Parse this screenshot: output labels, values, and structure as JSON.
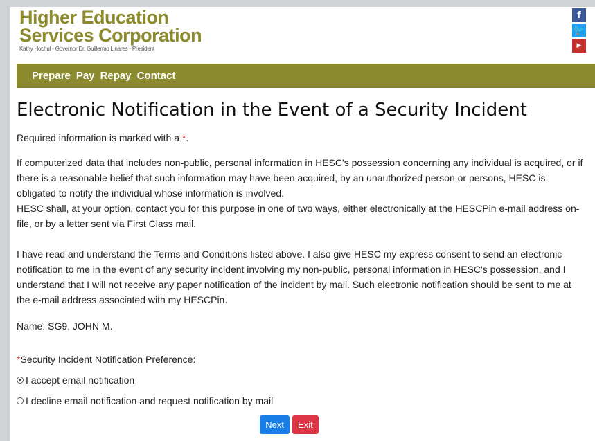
{
  "header": {
    "logo_line1": "Higher Education",
    "logo_line2": "Services Corporation",
    "logo_sub": "Kathy Hochul - Governor   Dr. Guillermo Linares - President",
    "social": [
      {
        "icon": "facebook-icon",
        "glyph": "f"
      },
      {
        "icon": "twitter-icon",
        "glyph": "🐦"
      },
      {
        "icon": "youtube-icon",
        "glyph": "You Tube"
      }
    ]
  },
  "nav": [
    "Prepare",
    "Pay",
    "Repay",
    "Contact"
  ],
  "page": {
    "title": "Electronic Notification in the Event of a Security Incident",
    "required_note": "Required information is marked with a ",
    "required_star": "*",
    "required_end": ".",
    "para1": "If computerized data that includes non-public, personal information in HESC's possession concerning any individual is acquired, or if there is a reasonable belief that such information may have been acquired, by an unauthorized person or persons, HESC is obligated to notify the individual whose information is involved.",
    "para2": "HESC shall, at your option, contact you for this purpose in one of two ways, either electronically at the HESCPin e-mail address on-file, or by a letter sent via First Class mail.",
    "para3": "I have read and understand the Terms and Conditions listed above. I also give HESC my express consent to send an electronic notification to me in the event of any security incident involving my non-public, personal information in HESC's possession, and I understand that I will not receive any paper notification of the incident by mail. Such electronic notification should be sent to me at the e-mail address associated with my HESCPin.",
    "name_line": "Name: SG9, JOHN M.",
    "pref_label": "Security Incident Notification Preference:",
    "options": [
      {
        "label": "I accept email notification",
        "checked": true
      },
      {
        "label": "I decline email notification and request notification by mail",
        "checked": false
      }
    ]
  },
  "buttons": {
    "next": "Next",
    "exit": "Exit"
  },
  "colors": {
    "brand": "#8b8a2f",
    "next": "#1a7ee8",
    "exit": "#dc3545",
    "required": "#e0312e"
  }
}
